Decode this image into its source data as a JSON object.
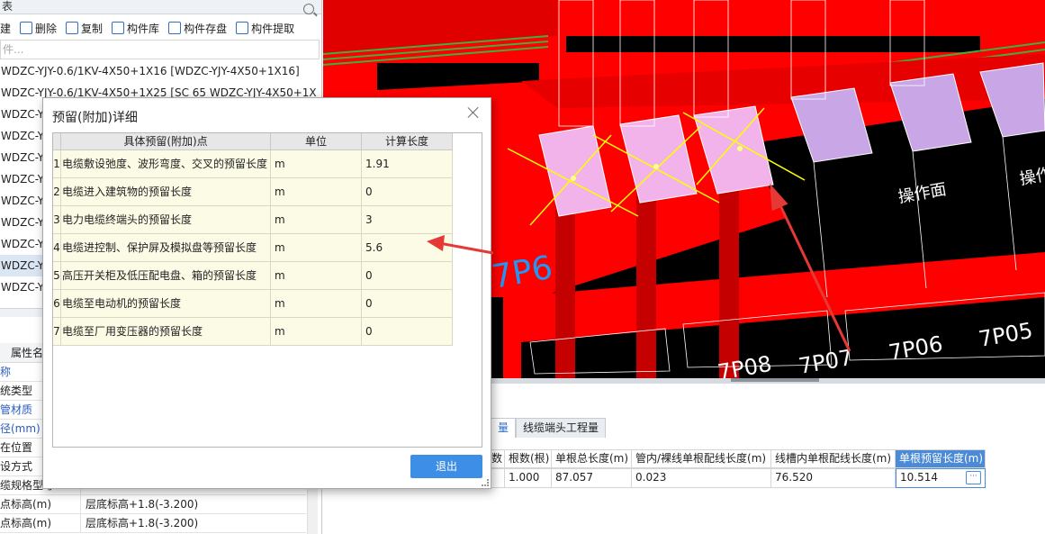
{
  "left_panel": {
    "title": "表",
    "toolbar": [
      {
        "label": "建",
        "icon": "new-icon"
      },
      {
        "label": "删除",
        "icon": "trash-icon"
      },
      {
        "label": "复制",
        "icon": "copy-icon"
      },
      {
        "label": "构件库",
        "icon": "library-icon"
      },
      {
        "label": "构件存盘",
        "icon": "save-component-icon"
      },
      {
        "label": "构件提取",
        "icon": "extract-icon"
      }
    ],
    "search_placeholder": "件...",
    "items": [
      "WDZC-YJY-0.6/1KV-4X50+1X16 [WDZC-YJY-4X50+1X16]",
      "WDZC-YJY-0.6/1KV-4X50+1X25 [SC 65 WDZC-YJY-4X50+1X",
      "WDZC-Y",
      "WDZC-Y",
      "WDZC-Y",
      "WDZC-Y",
      "WDZC-Y",
      "WDZC-Y",
      "WDZC-Y",
      "WDZC-Y",
      "WDZC-Y"
    ],
    "selected_index": 9,
    "prop_header": "属性名",
    "props": [
      {
        "k": "称",
        "v": "",
        "blue": true
      },
      {
        "k": "统类型",
        "v": "",
        "blue": false
      },
      {
        "k": "管材质",
        "v": "",
        "blue": true
      },
      {
        "k": "径(mm)",
        "v": "",
        "blue": true
      },
      {
        "k": "在位置",
        "v": "",
        "blue": false
      },
      {
        "k": "设方式",
        "v": "",
        "blue": false
      },
      {
        "k": "缆规格型号",
        "v": "",
        "blue": false
      },
      {
        "k": "点标高(m)",
        "v": "层底标高+1.8(-3.200)",
        "blue": false
      },
      {
        "k": "点标高(m)",
        "v": "层底标高+1.8(-3.200)",
        "blue": false
      }
    ]
  },
  "cad": {
    "labels": [
      "操作面",
      "操作",
      "7P6",
      "7P07",
      "7P06",
      "7P05",
      "7P08"
    ],
    "colors": {
      "bg": "#000000",
      "red": "#ff0000",
      "green": "#3cb043",
      "yellow": "#ffff00",
      "pink": "#e8a0e0",
      "white": "#ffffff",
      "arrow": "#e53935"
    }
  },
  "bottom_table": {
    "tabs": [
      {
        "label": "量",
        "active": true
      },
      {
        "label": "线缆端头工程量",
        "active": false
      }
    ],
    "headers": [
      "数",
      "根数(根)",
      "单根总长度(m)",
      "管内/裸线单根配线长度(m)",
      "线槽内单根配线长度(m)",
      "单根预留长度(m)"
    ],
    "row": [
      "",
      "1.000",
      "87.057",
      "0.023",
      "76.520",
      "10.514"
    ],
    "ellipsis": "···"
  },
  "dialog": {
    "title": "预留(附加)详细",
    "columns": [
      "具体预留(附加)点",
      "单位",
      "计算长度"
    ],
    "rows": [
      {
        "no": "1",
        "name": "电缆敷设弛度、波形弯度、交叉的预留长度",
        "unit": "m",
        "value": "1.91"
      },
      {
        "no": "2",
        "name": "电缆进入建筑物的预留长度",
        "unit": "m",
        "value": "0"
      },
      {
        "no": "3",
        "name": "电力电缆终端头的预留长度",
        "unit": "m",
        "value": "3"
      },
      {
        "no": "4",
        "name": "电缆进控制、保护屏及模拟盘等预留长度",
        "unit": "m",
        "value": "5.6"
      },
      {
        "no": "5",
        "name": "高压开关柜及低压配电盘、箱的预留长度",
        "unit": "m",
        "value": "0"
      },
      {
        "no": "6",
        "name": "电缆至电动机的预留长度",
        "unit": "m",
        "value": "0"
      },
      {
        "no": "7",
        "name": "电缆至厂用变压器的预留长度",
        "unit": "m",
        "value": "0"
      }
    ],
    "exit_label": "退出"
  }
}
